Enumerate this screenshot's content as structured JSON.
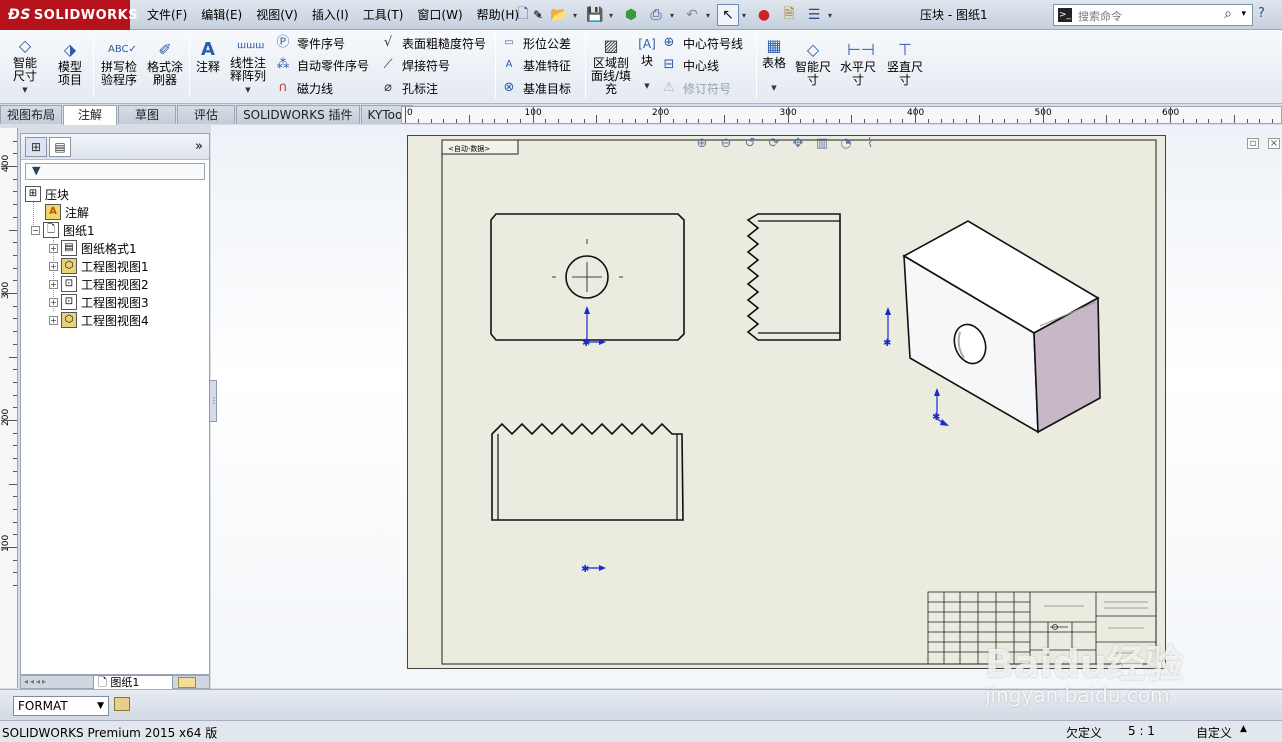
{
  "app": {
    "brand": "SOLIDWORKS",
    "document_title": "压块 - 图纸1",
    "accent": "#b5121b"
  },
  "menu": [
    "文件(F)",
    "编辑(E)",
    "视图(V)",
    "插入(I)",
    "工具(T)",
    "窗口(W)",
    "帮助(H)"
  ],
  "search": {
    "placeholder": "搜索命令"
  },
  "ribbon": {
    "smart_dim": "智能尺寸",
    "model_items": "模型项目",
    "spell_check": "拼写检验程序",
    "format_painter": "格式涂刷器",
    "note": "注释",
    "linear_note": "线性注释阵列",
    "balloon": "零件序号",
    "auto_balloon": "自动零件序号",
    "magnetic_line": "磁力线",
    "surface_finish": "表面粗糙度符号",
    "weld_symbol": "焊接符号",
    "hole_callout": "孔标注",
    "geom_tol": "形位公差",
    "datum_feature": "基准特征",
    "datum_target": "基准目标",
    "area_hatch": "区域剖面线/填充",
    "block": "块",
    "center_mark": "中心符号线",
    "centerline": "中心线",
    "revision_symbol": "修订符号",
    "table": "表格",
    "smart_dim2": "智能尺寸",
    "horizontal_dim": "水平尺寸",
    "vertical_dim": "竖直尺寸"
  },
  "tabs": [
    "视图布局",
    "注解",
    "草图",
    "评估",
    "SOLIDWORKS 插件",
    "KYTool"
  ],
  "active_tab": "注解",
  "h_ruler_ticks": [
    "0",
    "100",
    "200",
    "300",
    "400",
    "500",
    "600"
  ],
  "v_ruler_ticks": [
    "400",
    "300",
    "200",
    "100"
  ],
  "tree": {
    "root": "压块",
    "annotations": "注解",
    "sheet": "图纸1",
    "items": [
      "图纸格式1",
      "工程图视图1",
      "工程图视图2",
      "工程图视图3",
      "工程图视图4"
    ]
  },
  "sheet_tab": "图纸1",
  "drawing_tag": "<自动-数据>",
  "format_select": "FORMAT",
  "status": {
    "product": "SOLIDWORKS Premium 2015 x64 版",
    "defined": "欠定义",
    "scale": "5 : 1",
    "custom": "自定义"
  },
  "watermark": {
    "big": "Baidu经验",
    "small": "jingyan.baidu.com"
  }
}
